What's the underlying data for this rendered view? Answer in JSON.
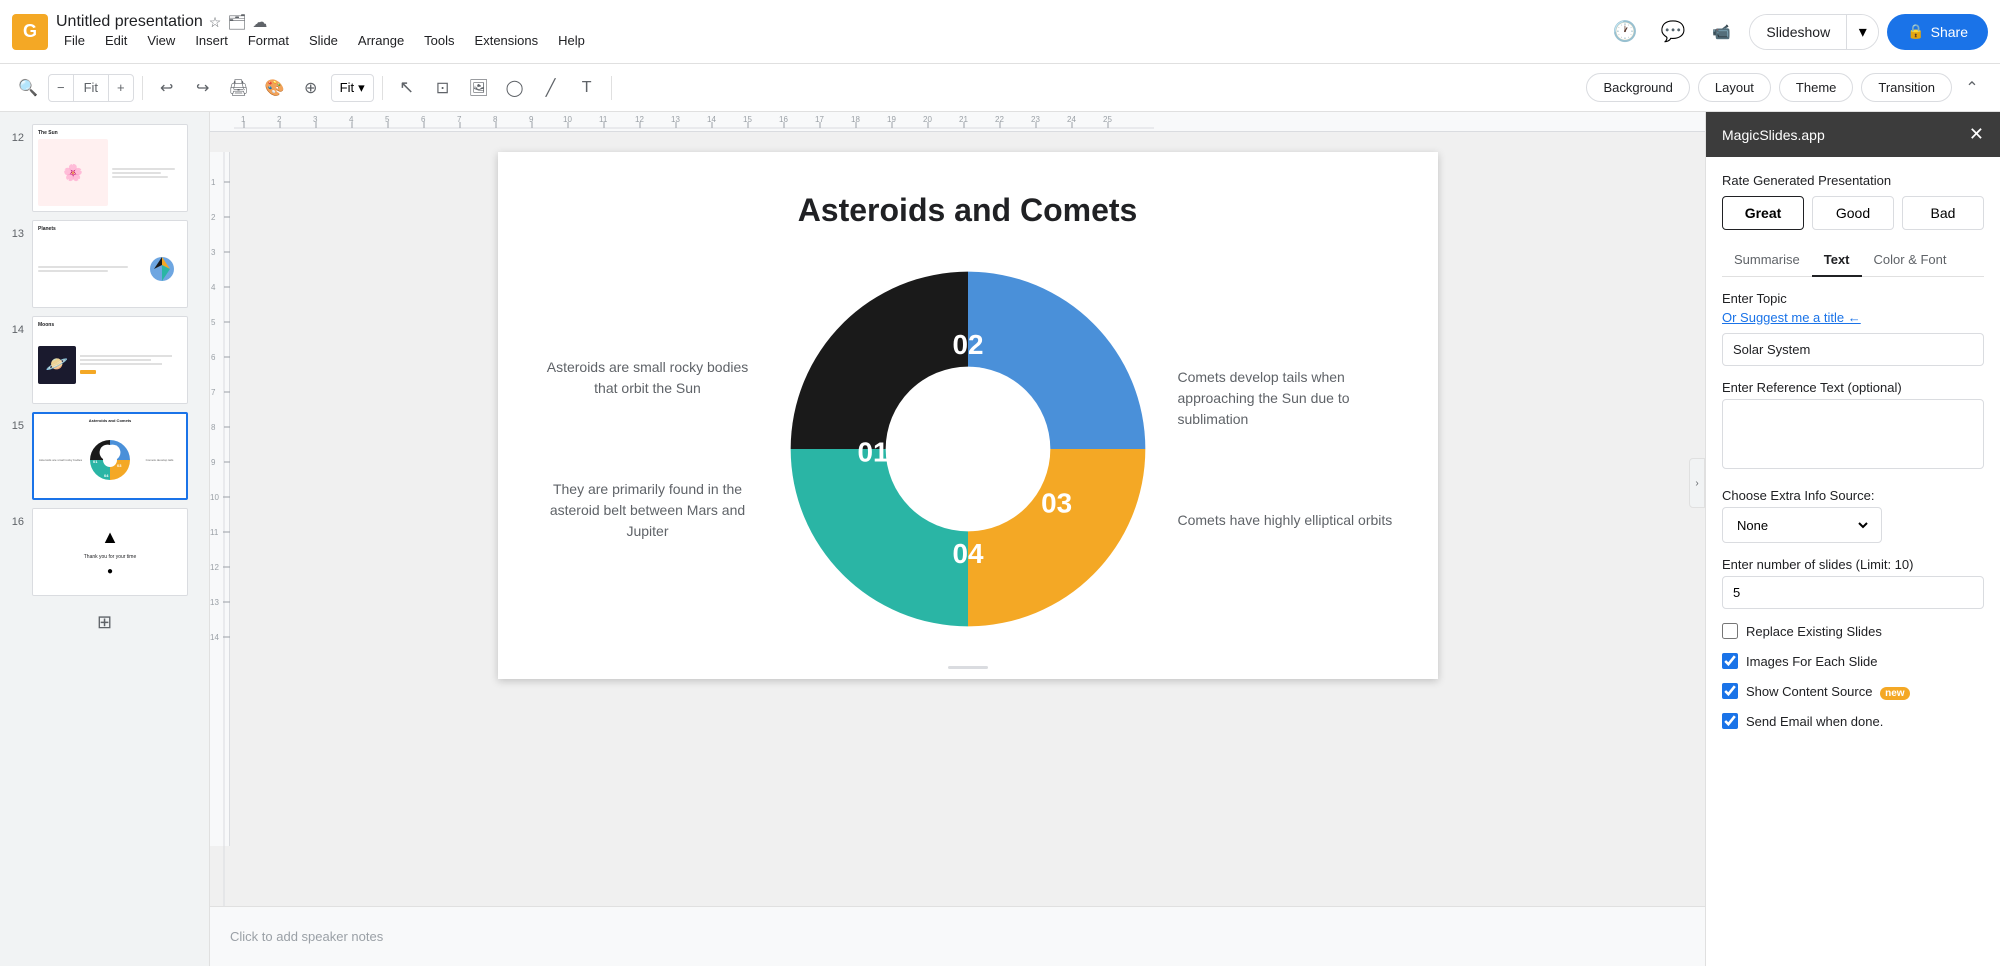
{
  "app": {
    "logo_letter": "G",
    "doc_title": "Untitled presentation",
    "star_icon": "☆",
    "folder_icon": "📁",
    "cloud_icon": "☁"
  },
  "menu": {
    "items": [
      "File",
      "Edit",
      "View",
      "Insert",
      "Format",
      "Slide",
      "Arrange",
      "Tools",
      "Extensions",
      "Help"
    ]
  },
  "top_actions": {
    "history_icon": "⟳",
    "comment_icon": "💬",
    "camera_icon": "📹",
    "slideshow_label": "Slideshow",
    "share_label": "Share"
  },
  "toolbar": {
    "zoom_value": "Fit",
    "cursor_icon": "↖",
    "background_label": "Background",
    "layout_label": "Layout",
    "theme_label": "Theme",
    "transition_label": "Transition"
  },
  "slides": [
    {
      "num": "12",
      "label": "The Sun",
      "active": false
    },
    {
      "num": "13",
      "label": "Planets",
      "active": false
    },
    {
      "num": "14",
      "label": "Moons",
      "active": false
    },
    {
      "num": "15",
      "label": "Asteroids and Comets",
      "active": true
    },
    {
      "num": "16",
      "label": "Thank you",
      "active": false
    }
  ],
  "current_slide": {
    "title": "Asteroids and Comets",
    "text_left_top": "Asteroids are small rocky bodies that orbit the Sun",
    "text_left_bottom": "They are primarily found in the asteroid belt between Mars and Jupiter",
    "text_right_top": "Comets develop tails when approaching the Sun due to sublimation",
    "text_right_bottom": "Comets have highly elliptical orbits",
    "chart": {
      "segments": [
        {
          "label": "01",
          "color": "#1a1a1a",
          "percent": 30
        },
        {
          "label": "02",
          "color": "#4a90d9",
          "percent": 25
        },
        {
          "label": "03",
          "color": "#f4a825",
          "percent": 25
        },
        {
          "label": "04",
          "color": "#2ab5a5",
          "percent": 20
        }
      ]
    }
  },
  "speaker_notes": {
    "placeholder": "Click to add speaker notes"
  },
  "right_panel": {
    "title": "MagicSlides.app",
    "close_icon": "✕",
    "section_rate": "Rate Generated Presentation",
    "rating_buttons": [
      "Great",
      "Good",
      "Bad"
    ],
    "tabs": [
      "Summarise",
      "Text",
      "Color & Font"
    ],
    "active_tab": "Text",
    "enter_topic_label": "Enter Topic",
    "suggest_link": "Or Suggest me a title ←",
    "topic_value": "Solar System",
    "topic_placeholder": "Solar System",
    "ref_text_label": "Enter Reference Text (optional)",
    "ref_text_placeholder": "",
    "extra_info_label": "Choose Extra Info Source:",
    "extra_info_option": "None",
    "num_slides_label": "Enter number of slides (Limit: 10)",
    "num_slides_value": "5",
    "replace_slides_label": "Replace Existing Slides",
    "replace_slides_checked": false,
    "images_label": "Images For Each Slide",
    "images_checked": true,
    "show_content_label": "Show Content Source",
    "show_content_checked": true,
    "new_badge": "new",
    "send_email_label": "Send Email when done.",
    "send_email_checked": true
  }
}
